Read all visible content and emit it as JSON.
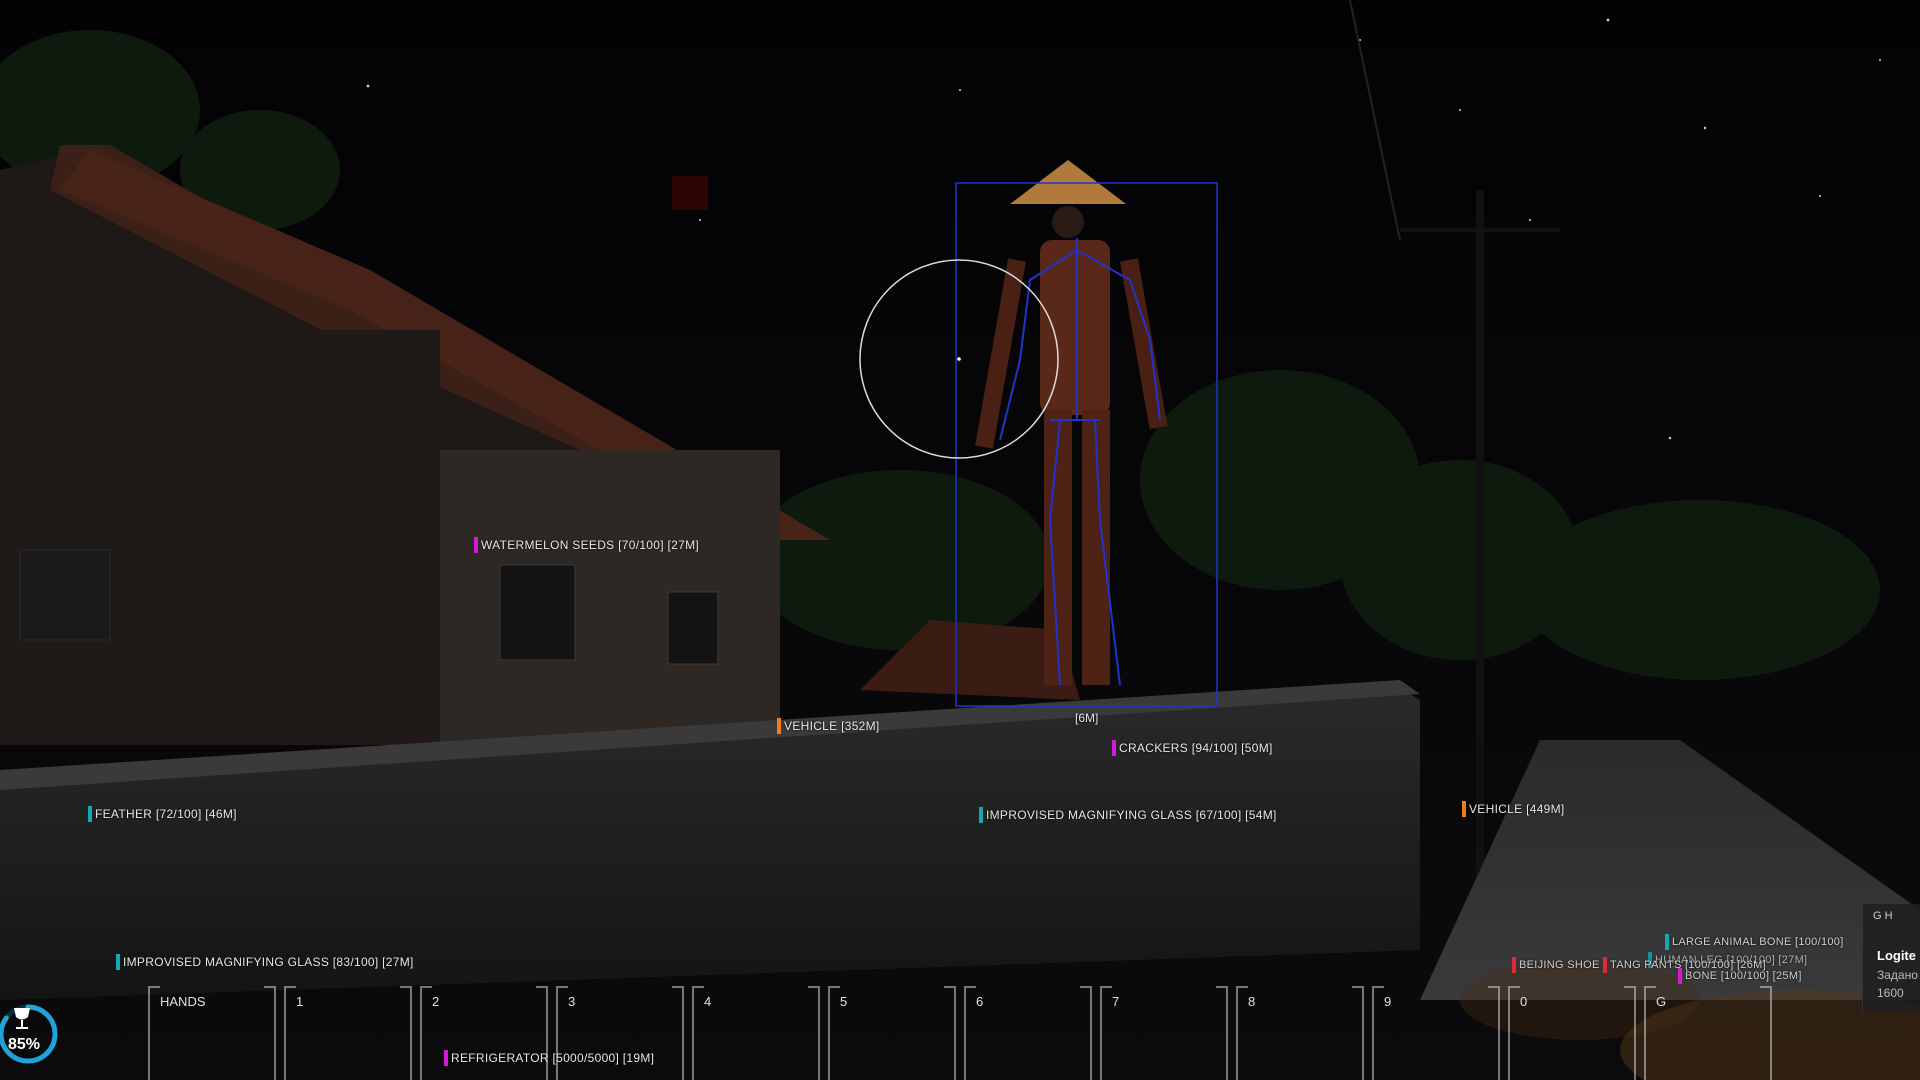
{
  "labels": {
    "watermelon_seeds": "WATERMELON SEEDS [70/100] [27M]",
    "vehicle_near": "VEHICLE [352M]",
    "target_distance": "[6M]",
    "crackers": "CRACKERS [94/100] [50M]",
    "feather": "FEATHER [72/100] [46M]",
    "magnifying_glass_54": "IMPROVISED MAGNIFYING GLASS [67/100] [54M]",
    "vehicle_far": "VEHICLE [449M]",
    "magnifying_glass_27": "IMPROVISED MAGNIFYING GLASS [83/100] [27M]",
    "large_animal_bone": "LARGE ANIMAL BONE [100/100]",
    "beijing_shoes": "BEIJING SHOE",
    "tang_pants": "TANG PANTS [100/100] [26M]",
    "human_leg": "HUMAN LEG [100/100] [27M]",
    "bone": "BONE [100/100] [25M]",
    "refrigerator": "REFRIGERATOR [5000/5000] [19M]"
  },
  "hotbar": {
    "slots": [
      "HANDS",
      "1",
      "2",
      "3",
      "4",
      "5",
      "6",
      "7",
      "8",
      "9",
      "0",
      "G"
    ]
  },
  "status": {
    "percent": "85%",
    "level": 0.85,
    "icon": "wine-glass-icon",
    "color": "#1fa3d8"
  },
  "side_panel": {
    "header": "G H",
    "brand": "Logite",
    "subtitle": "Задано",
    "value": "1600"
  },
  "colors": {
    "bbox": "#2233cc",
    "magenta": "#d51ad5",
    "teal": "#14a8b0",
    "orange": "#f07b1c"
  }
}
